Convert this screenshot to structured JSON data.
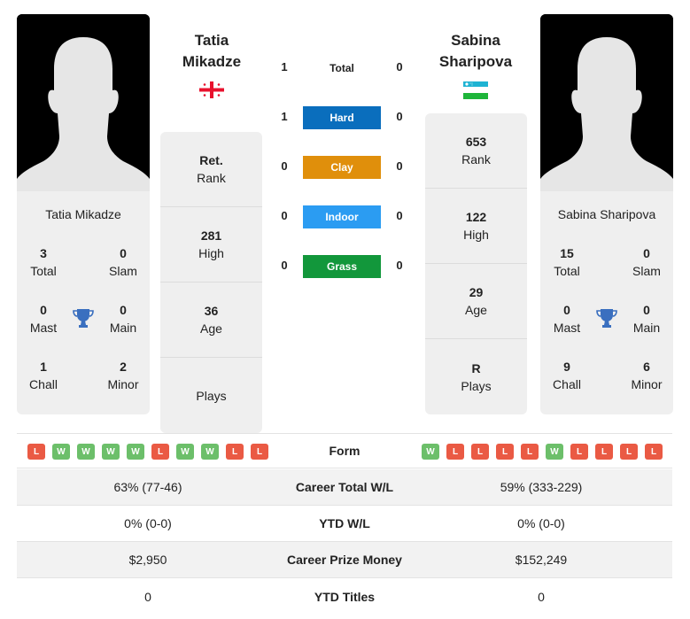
{
  "player1": {
    "name_line1": "Tatia",
    "name_line2": "Mikadze",
    "card_name": "Tatia Mikadze",
    "flag": "georgia-flag",
    "titles": {
      "total": {
        "value": "3",
        "label": "Total"
      },
      "slam": {
        "value": "0",
        "label": "Slam"
      },
      "mast": {
        "value": "0",
        "label": "Mast"
      },
      "main": {
        "value": "0",
        "label": "Main"
      },
      "chall": {
        "value": "1",
        "label": "Chall"
      },
      "minor": {
        "value": "2",
        "label": "Minor"
      }
    },
    "rank": {
      "value": "Ret.",
      "label": "Rank"
    },
    "high": {
      "value": "281",
      "label": "High"
    },
    "age": {
      "value": "36",
      "label": "Age"
    },
    "plays": {
      "value": "",
      "label": "Plays"
    },
    "form": [
      "L",
      "W",
      "W",
      "W",
      "W",
      "L",
      "W",
      "W",
      "L",
      "L"
    ],
    "career_wl": "63% (77-46)",
    "ytd_wl": "0% (0-0)",
    "prize_money": "$2,950",
    "ytd_titles": "0"
  },
  "player2": {
    "name_line1": "Sabina",
    "name_line2": "Sharipova",
    "card_name": "Sabina Sharipova",
    "flag": "uzbekistan-flag",
    "titles": {
      "total": {
        "value": "15",
        "label": "Total"
      },
      "slam": {
        "value": "0",
        "label": "Slam"
      },
      "mast": {
        "value": "0",
        "label": "Mast"
      },
      "main": {
        "value": "0",
        "label": "Main"
      },
      "chall": {
        "value": "9",
        "label": "Chall"
      },
      "minor": {
        "value": "6",
        "label": "Minor"
      }
    },
    "rank": {
      "value": "653",
      "label": "Rank"
    },
    "high": {
      "value": "122",
      "label": "High"
    },
    "age": {
      "value": "29",
      "label": "Age"
    },
    "plays": {
      "value": "R",
      "label": "Plays"
    },
    "form": [
      "W",
      "L",
      "L",
      "L",
      "L",
      "W",
      "L",
      "L",
      "L",
      "L"
    ],
    "career_wl": "59% (333-229)",
    "ytd_wl": "0% (0-0)",
    "prize_money": "$152,249",
    "ytd_titles": "0"
  },
  "h2h": {
    "total": {
      "label": "Total",
      "p1": "1",
      "p2": "0"
    },
    "surfaces": [
      {
        "label": "Hard",
        "p1": "1",
        "p2": "0",
        "color": "#0a6ebd"
      },
      {
        "label": "Clay",
        "p1": "0",
        "p2": "0",
        "color": "#e08f0b"
      },
      {
        "label": "Indoor",
        "p1": "0",
        "p2": "0",
        "color": "#2b9cf2"
      },
      {
        "label": "Grass",
        "p1": "0",
        "p2": "0",
        "color": "#12973b"
      }
    ]
  },
  "rows": {
    "form_label": "Form",
    "career_wl_label": "Career Total W/L",
    "ytd_wl_label": "YTD W/L",
    "prize_money_label": "Career Prize Money",
    "ytd_titles_label": "YTD Titles"
  },
  "colors": {
    "win": "#6cbf6a",
    "loss": "#ea5a44",
    "trophy": "#3a6fbf"
  }
}
